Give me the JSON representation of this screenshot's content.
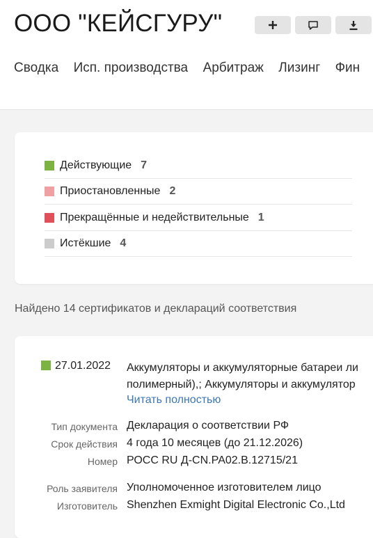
{
  "header": {
    "title": "ООО \"КЕЙСГУРУ\"",
    "buttons": [
      {
        "icon": "plus-icon"
      },
      {
        "icon": "comment-icon"
      },
      {
        "icon": "download-icon"
      }
    ],
    "tabs": [
      "Сводка",
      "Исп. производства",
      "Арбитраж",
      "Лизинг",
      "Фин"
    ]
  },
  "summary": {
    "items": [
      {
        "label": "Действующие",
        "count": "7",
        "color": "#7cb342"
      },
      {
        "label": "Приостановленные",
        "count": "2",
        "color": "#f0a0a0"
      },
      {
        "label": "Прекращённые и недействительные",
        "count": "1",
        "color": "#e0505a"
      },
      {
        "label": "Истёкшие",
        "count": "4",
        "color": "#cccccc"
      }
    ]
  },
  "found_text": "Найдено 14 сертификатов и деклараций соответствия",
  "certificate": {
    "status_color": "#7cb342",
    "date": "27.01.2022",
    "description_line1": "Аккумуляторы и аккумуляторные батареи ли",
    "description_line2": "полимерный),; Аккумуляторы и аккумулятор",
    "read_more": "Читать полностью",
    "properties": [
      {
        "label": "Тип документа",
        "value": "Декларация о соответствии РФ"
      },
      {
        "label": "Срок действия",
        "value": "4 года 10 месяцев (до 21.12.2026)"
      },
      {
        "label": "Номер",
        "value": "РОСС RU Д-CN.РА02.В.12715/21"
      },
      {
        "label": "Роль заявителя",
        "value": "Уполномоченное изготовителем лицо"
      },
      {
        "label": "Изготовитель",
        "value": "Shenzhen Exmight Digital Electronic Co.,Ltd"
      }
    ]
  }
}
